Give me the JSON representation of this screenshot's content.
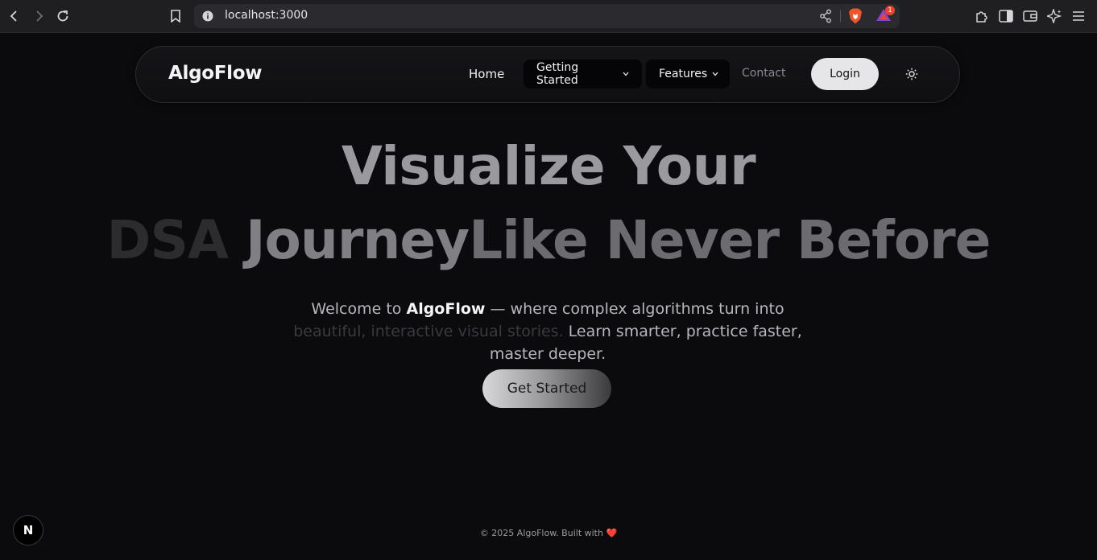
{
  "browser": {
    "url": "localhost:3000",
    "rewards_badge": "1",
    "icons": [
      "back-icon",
      "forward-icon",
      "reload-icon",
      "bookmark-icon",
      "site-info-icon",
      "share-icon",
      "brave-shield-icon",
      "brave-rewards-icon",
      "extensions-icon",
      "sidebar-icon",
      "wallet-icon",
      "leo-ai-icon",
      "menu-icon"
    ]
  },
  "navbar": {
    "logo": "AlgoFlow",
    "home": "Home",
    "getting_started": "Getting Started",
    "features": "Features",
    "contact": "Contact",
    "login": "Login",
    "theme_icon": "sun-icon"
  },
  "hero": {
    "line1": "Visualize Your",
    "line2_a": "DSA ",
    "line2_b": "Journey",
    "line2_c": "Like Never Before",
    "desc_pre": "Welcome to ",
    "desc_brand": "AlgoFlow",
    "desc_mid": " — where complex algorithms turn into ",
    "desc_dim": "beautiful, interactive visual stories.",
    "desc_post": " Learn smarter, practice faster, master deeper.",
    "cta": "Get Started"
  },
  "footer": {
    "text": "© 2025 AlgoFlow. Built with",
    "heart": "❤️"
  },
  "dev": {
    "badge": "N"
  },
  "colors": {
    "background": "#0b0b0d",
    "login_bg": "#e6e6e8",
    "heart": "#e0413b"
  }
}
